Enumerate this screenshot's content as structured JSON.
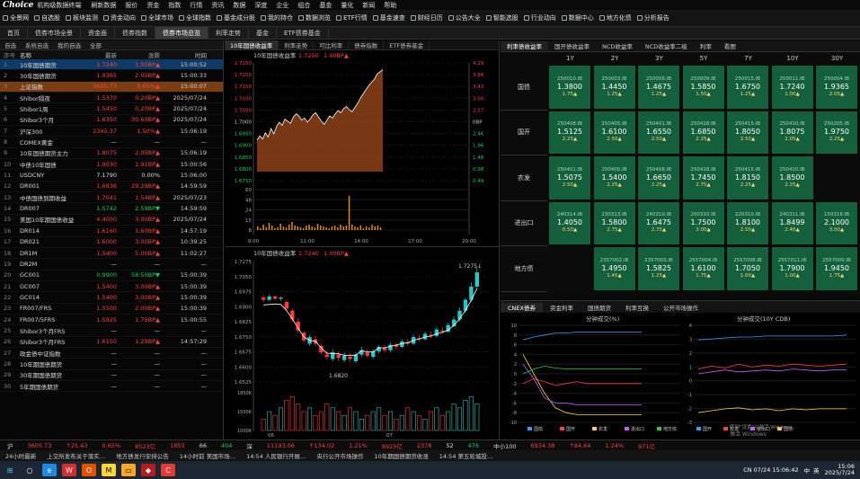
{
  "app": {
    "logo_text": "Choice",
    "logo_e": "e",
    "subtitle": "机构级数据终端"
  },
  "menu": [
    "刷新数据",
    "报价",
    "资金",
    "指数",
    "行情",
    "资讯",
    "数据",
    "深度",
    "企业",
    "组合",
    "基金",
    "量化",
    "新闻",
    "帮助"
  ],
  "shortcuts": [
    "全景网",
    "自选股",
    "板块监测",
    "资金动向",
    "全球市场",
    "全球指数",
    "基金成分股",
    "我的持仓",
    "数据浏览",
    "ETF行情",
    "基金速查",
    "财经日历",
    "公告大全",
    "智能选股",
    "行业动向",
    "数据中心",
    "地方化债",
    "分析报告"
  ],
  "tabs": [
    "首页",
    "债券市场全景",
    "资金面",
    "债券指数",
    "债券市场总览",
    "利率走势",
    "基金",
    "ETF债券基金"
  ],
  "watchlist": {
    "header": [
      "自选",
      "系统自选",
      "",
      "我的自选",
      "全部"
    ],
    "columns": [
      "序号",
      "名称",
      "最新",
      "涨跌",
      "时间"
    ],
    "rows": [
      [
        "1",
        "10年国债期货",
        "1.7240",
        "1.00BP▲",
        "15:00:52",
        "up",
        "sel1"
      ],
      [
        "2",
        "30年国债期货",
        "1.9365",
        "2.05BP▲",
        "15:00:33",
        "up",
        ""
      ],
      [
        "3",
        "上证指数",
        "3605.73",
        "0.65%▲",
        "15:00:07",
        "up",
        "sel2"
      ],
      [
        "4",
        "Shibor隔夜",
        "1.5370",
        "0.20BP▲",
        "2025/07/24",
        "up",
        ""
      ],
      [
        "5",
        "Shibor1周",
        "1.5450",
        "0.20BP▲",
        "2025/07/24",
        "up",
        ""
      ],
      [
        "6",
        "Shibor3个月",
        "1.6350",
        "30.60BP▲",
        "2025/07/24",
        "up",
        ""
      ],
      [
        "7",
        "沪深300",
        "2345.37",
        "1.50%▲",
        "15:06:19",
        "up",
        ""
      ],
      [
        "8",
        "COMEX黄金",
        "—",
        "—",
        "—",
        "nt",
        ""
      ],
      [
        "9",
        "10年国债期货主力",
        "1.8075",
        "2.05BP▲",
        "15:06:19",
        "up",
        ""
      ],
      [
        "10",
        "中债10年国债",
        "1.9030",
        "1.91BP▲",
        "15:00:56",
        "up",
        ""
      ],
      [
        "11",
        "USDCNY",
        "7.1790",
        "0.00%",
        "15:06:00",
        "nt",
        ""
      ],
      [
        "12",
        "DR001",
        "1.6836",
        "29.29BP▲",
        "14:59:59",
        "up",
        ""
      ],
      [
        "13",
        "中债国债到期收益",
        "1.7041",
        "1.54BP▲",
        "2025/07/23",
        "up",
        ""
      ],
      [
        "14",
        "DR007",
        "1.5742",
        "2.59BP▼",
        "14:59:59",
        "dn",
        ""
      ],
      [
        "15",
        "美国10年期国债收益",
        "4.4000",
        "3.00BP▲",
        "2025/07/24",
        "up",
        ""
      ],
      [
        "16",
        "DR014",
        "1.6160",
        "1.60BP▲",
        "14:57:19",
        "up",
        ""
      ],
      [
        "17",
        "DR021",
        "1.6000",
        "3.00BP▲",
        "10:39:25",
        "up",
        ""
      ],
      [
        "18",
        "DR1M",
        "1.5400",
        "5.00BP▲",
        "11:02:27",
        "up",
        ""
      ],
      [
        "19",
        "DR2M",
        "—",
        "—",
        "—",
        "nt",
        ""
      ],
      [
        "20",
        "GC001",
        "0.9900",
        "58.50BP▼",
        "15:00:39",
        "dn",
        ""
      ],
      [
        "21",
        "GC007",
        "1.5400",
        "3.00BP▲",
        "15:00:39",
        "up",
        ""
      ],
      [
        "22",
        "GC014",
        "1.5400",
        "3.00BP▲",
        "15:00:39",
        "up",
        ""
      ],
      [
        "23",
        "FR007/FRS",
        "1.5500",
        "2.00BP▲",
        "15:00:39",
        "up",
        ""
      ],
      [
        "24",
        "FR007/5FRS",
        "1.5925",
        "1.75BP▲",
        "15:00:55",
        "up",
        ""
      ],
      [
        "25",
        "Shibor3个月FRS",
        "—",
        "—",
        "—",
        "nt",
        ""
      ],
      [
        "26",
        "Shibor3个月FRS",
        "1.6150",
        "1.25BP▲",
        "14:57:29",
        "up",
        ""
      ],
      [
        "27",
        "政金债中证指数",
        "—",
        "—",
        "—",
        "nt",
        ""
      ],
      [
        "28",
        "10年期国债期货",
        "—",
        "—",
        "—",
        "nt",
        ""
      ],
      [
        "29",
        "30年期国债期货",
        "—",
        "—",
        "—",
        "nt",
        ""
      ],
      [
        "30",
        "5年期国债期货",
        "—",
        "—",
        "—",
        "nt",
        ""
      ]
    ]
  },
  "charts": {
    "tabs": [
      "10年国债收益率",
      "利率走势",
      "可比利率",
      "债券指数",
      "ETF债券基金"
    ],
    "top_title": "10年国债收益率",
    "top_last": "1.7250",
    "top_chg": "1.90BP▲",
    "bottom_title": "10年国债收益率",
    "bottom_last": "1.7240",
    "bottom_chg": "1.00BP▲",
    "top_yaxis_left": [
      "1.7250",
      "1.7200",
      "1.7150",
      "1.7100",
      "1.7050",
      "1.7000",
      "1.6950",
      "1.6900",
      "1.6850",
      "1.6800",
      "1.6750"
    ],
    "top_yaxis_right": [
      "4.29",
      "3.86",
      "3.43",
      "3.00",
      "2.57",
      "0BP",
      "2.46",
      "1.96",
      "1.48",
      "0.98",
      "0.49"
    ],
    "top_xaxis": [
      "9:00",
      "11:00",
      "14:00",
      "17:00",
      "20:00"
    ],
    "top_vol_axis": [
      "60",
      "48",
      "24",
      "15",
      "8"
    ],
    "bottom_yaxis": [
      "1.7275",
      "1.7050",
      "1.6975",
      "1.6900",
      "1.6825",
      "1.6750",
      "1.6675",
      "1.6600",
      "1.6525"
    ],
    "bottom_xaxis": [
      "06",
      "07"
    ],
    "high_label": "1.7275↓",
    "low_label": "1.6820",
    "bottom_vol_axis": [
      "1850K",
      "1500K",
      "1000K"
    ]
  },
  "curve_grid": {
    "tabs": [
      "利率债收益率",
      "国开债收益率",
      "NCD收益率",
      "NCD收益率二级",
      "利率",
      "看图"
    ],
    "columns": [
      "1Y",
      "2Y",
      "3Y",
      "5Y",
      "7Y",
      "10Y",
      "30Y"
    ],
    "rows": [
      {
        "label": "国债",
        "cells": [
          [
            "250010.IB",
            "1.3800",
            "1.75▲"
          ],
          [
            "250003.IB",
            "1.4450",
            "1.25▲"
          ],
          [
            "250006.IB",
            "1.4675",
            "1.25▲"
          ],
          [
            "250009.IB",
            "1.5850",
            "1.50▲"
          ],
          [
            "250015.IB",
            "1.6750",
            "1.25▲"
          ],
          [
            "250011.IB",
            "1.7240",
            "1.00▲"
          ],
          [
            "250004.IB",
            "1.9365",
            "2.05▲"
          ]
        ]
      },
      {
        "label": "国开",
        "cells": [
          [
            "250408.IB",
            "1.5125",
            "2.25▲"
          ],
          [
            "250405.IB",
            "1.6100",
            "2.50▲"
          ],
          [
            "250401.IB",
            "1.6550",
            "2.50▲"
          ],
          [
            "250418.IB",
            "1.6850",
            "2.25▲"
          ],
          [
            "250415.IB",
            "1.8050",
            "2.50▲"
          ],
          [
            "250410.IB",
            "1.8075",
            "2.05▲"
          ],
          [
            "250205.IB",
            "1.9750",
            "2.25▲"
          ]
        ]
      },
      {
        "label": "农发",
        "cells": [
          [
            "250401.IB",
            "1.5075",
            "2.50▲"
          ],
          [
            "250405.IB",
            "1.5400",
            "2.25▲"
          ],
          [
            "250408.IB",
            "1.6650",
            "2.25▲"
          ],
          [
            "250418.IB",
            "1.7450",
            "2.75▲"
          ],
          [
            "250415.IB",
            "1.8150",
            "2.25▲"
          ],
          [
            "250410.IB",
            "1.8500",
            "2.25▲"
          ],
          null
        ]
      },
      {
        "label": "进出口",
        "cells": [
          [
            "240314.IB",
            "1.4050",
            "0.50▲"
          ],
          [
            "230313.IB",
            "1.5800",
            "2.75▲"
          ],
          [
            "240310.IB",
            "1.6475",
            "2.75▲"
          ],
          [
            "200310.IB",
            "1.7500",
            "3.00▲"
          ],
          [
            "220310.IB",
            "1.8100",
            "2.50▲"
          ],
          [
            "240311.IB",
            "1.8499",
            "2.40▲"
          ],
          [
            "150318.IB",
            "2.1000",
            "3.00▲"
          ]
        ]
      },
      {
        "label": "地方债",
        "cells": [
          null,
          [
            "2357002.IB",
            "1.4950",
            "1.45▲"
          ],
          [
            "2357003.IB",
            "1.5825",
            "1.25▲"
          ],
          [
            "2557004.IB",
            "1.6100",
            "1.75▲"
          ],
          [
            "2557008.IB",
            "1.7050",
            "1.00▲"
          ],
          [
            "2557011.IB",
            "1.7900",
            "1.00▲"
          ],
          [
            "2557009.IB",
            "1.9450",
            "1.75▲"
          ]
        ]
      }
    ]
  },
  "lower": {
    "tabs": [
      "CNEX债券",
      "资金利率",
      "国债期货",
      "利率互换",
      "公开市场操作"
    ],
    "left_title": "分钟成交(%)",
    "right_title": "分钟成交(10Y CDB)",
    "left_yaxis": [
      "10",
      "8",
      "6",
      "4",
      "2",
      "0",
      "-2",
      "-4",
      "-6",
      "-8",
      "-10"
    ],
    "right_yaxis": [
      "4",
      "3",
      "2",
      "1",
      "0",
      "-1",
      "-2",
      "-3"
    ],
    "left_legend": [
      "国债",
      "国开",
      "农发",
      "进出口",
      "地方债"
    ],
    "right_legend": [
      "国开",
      "农发",
      "进出口",
      "国债"
    ],
    "watermark1": "激活 Windows",
    "watermark2": "转到\"设置\"以激活 Windows。"
  },
  "indexbar": [
    [
      "沪",
      "nt"
    ],
    [
      "3605.73",
      "up"
    ],
    [
      "↑25.43",
      "up"
    ],
    [
      "0.65%",
      "up"
    ],
    [
      "8523亿",
      "up"
    ],
    [
      "1855",
      "up"
    ],
    [
      "66",
      "nt"
    ],
    [
      "404",
      "dn"
    ],
    [
      "深",
      "nt"
    ],
    [
      "11193.06",
      "up"
    ],
    [
      "↑134.02",
      "up"
    ],
    [
      "1.21%",
      "up"
    ],
    [
      "8925亿",
      "up"
    ],
    [
      "2378",
      "up"
    ],
    [
      "52",
      "nt"
    ],
    [
      "476",
      "dn"
    ],
    [
      "中小100",
      "nt"
    ],
    [
      "6934.38",
      "up"
    ],
    [
      "↑84.64",
      "up"
    ],
    [
      "1.24%",
      "up"
    ],
    [
      "971亿",
      "up"
    ]
  ],
  "news": [
    "24小时最新",
    "上交所发布关于落实…",
    "地方债发行安排公告",
    "14小时前 美国市场…",
    "14:54 人民银行开展…",
    "央行公开市场操作",
    "10年期国债期货收涨",
    "14:54 第五轮城投…"
  ],
  "taskbar": {
    "time": "15:06",
    "date": "2025/7/24",
    "ime": "中",
    "lang": "英",
    "status_text": "CN 07/24 15:06:42"
  },
  "colors": {
    "up": "#ff4040",
    "down": "#22cc55",
    "cell_bg": "#14603c",
    "accent": "#0d3a66"
  }
}
